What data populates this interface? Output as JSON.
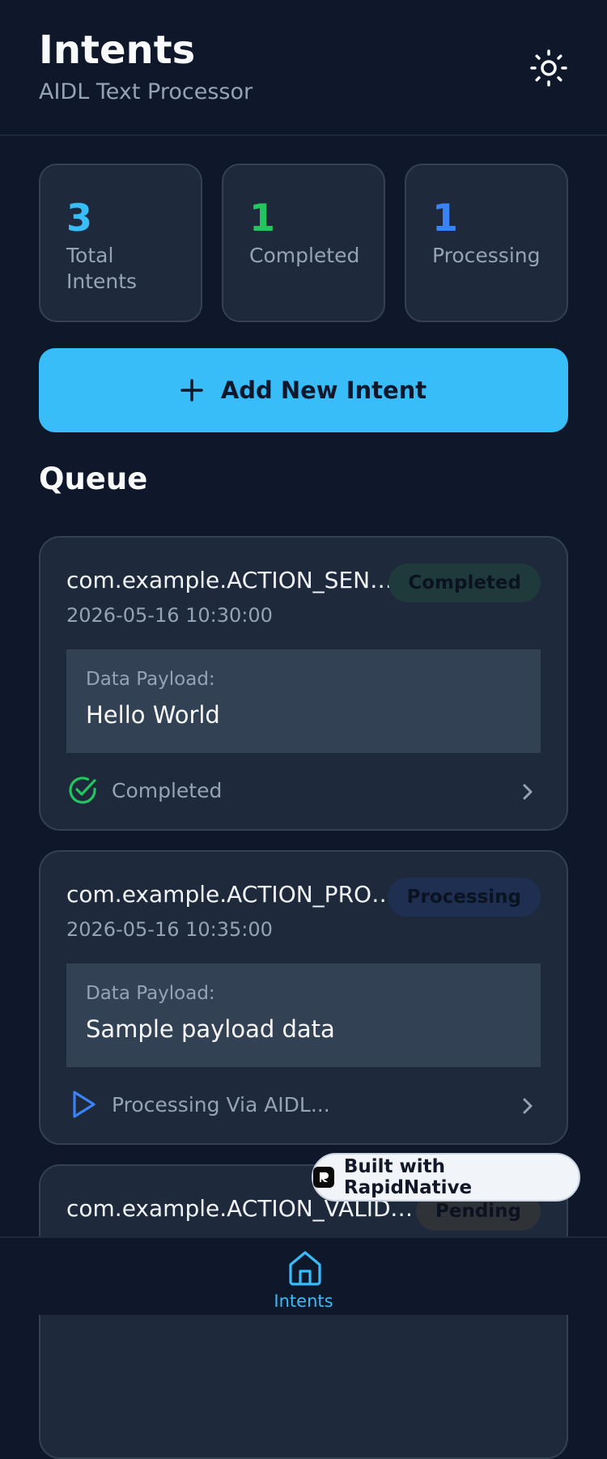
{
  "header": {
    "title": "Intents",
    "subtitle": "AIDL Text Processor",
    "theme_icon": "sun-icon"
  },
  "stats": [
    {
      "value": "3",
      "label": "Total Intents",
      "color": "#38bdf8"
    },
    {
      "value": "1",
      "label": "Completed",
      "color": "#22c55e"
    },
    {
      "value": "1",
      "label": "Processing",
      "color": "#3b82f6"
    }
  ],
  "add_button": {
    "label": "Add New Intent",
    "icon": "plus-icon"
  },
  "queue": {
    "title": "Queue",
    "items": [
      {
        "action": "com.example.ACTION_SEND_...",
        "badge": "Completed",
        "badge_color": "#1f3a3a",
        "timestamp": "2026-05-16 10:30:00",
        "payload_label": "Data Payload:",
        "payload": "Hello World",
        "status_text": "Completed",
        "status_icon": "check-circle-icon",
        "status_color": "#22c55e"
      },
      {
        "action": "com.example.ACTION_PROCE...",
        "badge": "Processing",
        "badge_color": "#1e2f52",
        "timestamp": "2026-05-16 10:35:00",
        "payload_label": "Data Payload:",
        "payload": "Sample payload data",
        "status_text": "Processing Via AIDL...",
        "status_icon": "play-icon",
        "status_color": "#3b82f6"
      },
      {
        "action": "com.example.ACTION_VALIDATE",
        "badge": "Pending",
        "badge_color": "#2f3338"
      }
    ]
  },
  "bottom_nav": {
    "items": [
      {
        "label": "Intents",
        "icon": "home-icon",
        "active": true
      }
    ]
  },
  "watermark": {
    "text": "Built with RapidNative"
  },
  "colors": {
    "background": "#0f172a",
    "card": "#1e293b",
    "accent": "#38bdf8"
  }
}
